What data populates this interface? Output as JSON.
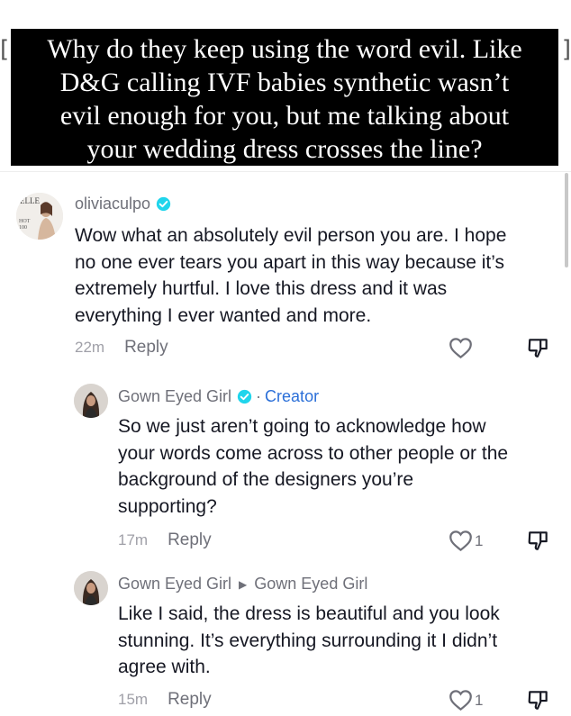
{
  "caption": {
    "lines": [
      "Why do they keep using the word evil. Like",
      "D&G calling IVF babies synthetic wasn’t",
      "evil enough for you, but me talking about",
      "your wedding dress crosses the line?"
    ]
  },
  "comments": [
    {
      "username": "oliviaculpo",
      "verified": true,
      "body_lines": [
        "Wow what an absolutely evil person you are. I hope",
        "no one ever tears you apart in this way because it’s",
        "extremely hurtful. I love this dress and it was",
        "everything I ever wanted and more."
      ],
      "time": "22m",
      "reply_label": "Reply",
      "like_count": ""
    },
    {
      "username": "Gown Eyed Girl",
      "verified": true,
      "separator": "·",
      "badge": "Creator",
      "body_lines": [
        "So we just aren’t going to acknowledge how",
        "your words come across to other people or the",
        "background of the designers you’re",
        "supporting?"
      ],
      "time": "17m",
      "reply_label": "Reply",
      "like_count": "1"
    },
    {
      "username": "Gown Eyed Girl",
      "reply_to": "Gown Eyed Girl",
      "body_lines": [
        "Like I said, the dress is beautiful and you look",
        "stunning. It’s everything surrounding it I didn’t",
        "agree with."
      ],
      "time": "15m",
      "reply_label": "Reply",
      "like_count": "1"
    }
  ],
  "colors": {
    "accent_blue": "#20d5ec",
    "creator_blue": "#2b6fd8",
    "text": "#161823",
    "muted": "#6f7079"
  }
}
